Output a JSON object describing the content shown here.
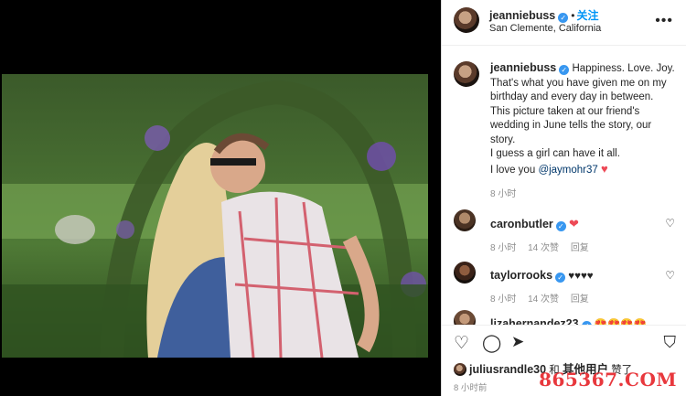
{
  "post": {
    "username": "jeanniebuss",
    "follow_label": "关注",
    "dot": "•",
    "location": "San Clemente, California"
  },
  "caption": {
    "username": "jeanniebuss",
    "lines": [
      "Happiness. Love. Joy.",
      "That's what you have given me on my",
      "birthday and every day in between.",
      "This picture taken at our friend's",
      "wedding in June tells the story, our",
      "story.",
      "I guess a girl can have it all.",
      "I love you"
    ],
    "mention": "@jaymohr37",
    "time": "8 小时"
  },
  "comments": [
    {
      "username": "caronbutler",
      "text": "❤",
      "time": "8 小时",
      "likes": "14 次赞",
      "reply": "回复"
    },
    {
      "username": "taylorrooks",
      "text": "♥♥♥♥",
      "time": "8 小时",
      "likes": "14 次赞",
      "reply": "回复"
    },
    {
      "username": "lizahernandez23",
      "text": "😍😍😍😍"
    }
  ],
  "likes": {
    "user": "juliusrandle30",
    "connector": "和",
    "others": "其他用户",
    "suffix": "赞了"
  },
  "time_bottom": "8 小时前",
  "watermark": "865367.COM",
  "icons": [
    "more-icon",
    "verified-icon",
    "heart-icon",
    "comment-icon",
    "share-icon",
    "bookmark-icon"
  ],
  "colors": {
    "accent": "#0095f6",
    "verified": "#3897f0",
    "like_red": "#ed4956",
    "watermark": "#e8383d"
  }
}
